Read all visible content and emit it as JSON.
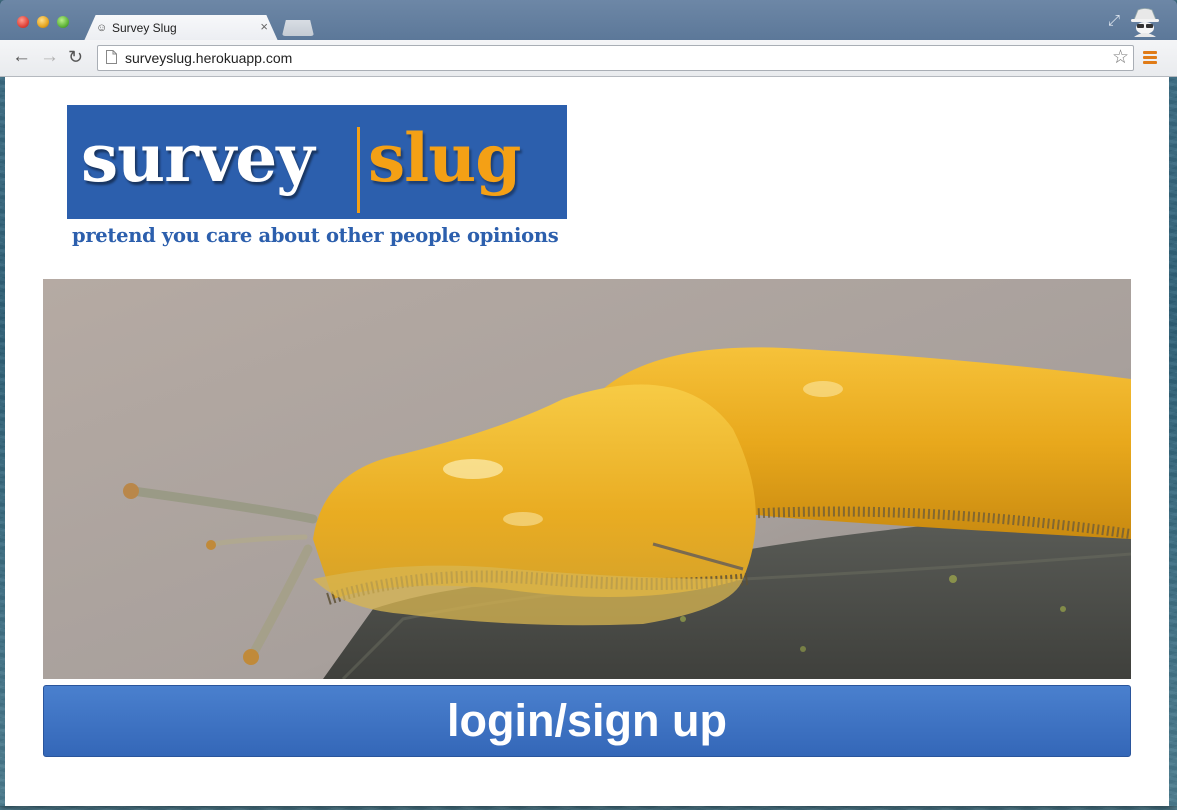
{
  "browser": {
    "tab": {
      "title": "Survey Slug",
      "close_glyph": "×",
      "favicon": "slug-favicon-icon"
    },
    "address_bar": {
      "url": "surveyslug.herokuapp.com"
    },
    "icons": {
      "back": "back-arrow-icon",
      "forward": "forward-arrow-icon",
      "reload": "reload-icon",
      "bookmark": "star-icon",
      "menu": "hamburger-menu-icon",
      "fullscreen": "fullscreen-icon",
      "incognito": "incognito-icon"
    }
  },
  "page": {
    "logo": {
      "word_left": "survey",
      "word_right": "slug",
      "tagline": "pretend you care about other people opinions",
      "colors": {
        "blue": "#2c5fad",
        "orange": "#f4a015"
      }
    },
    "hero_image": "banana-slug-photo",
    "login_button": {
      "label": "login/sign up",
      "color": "#3a6ebf"
    }
  }
}
